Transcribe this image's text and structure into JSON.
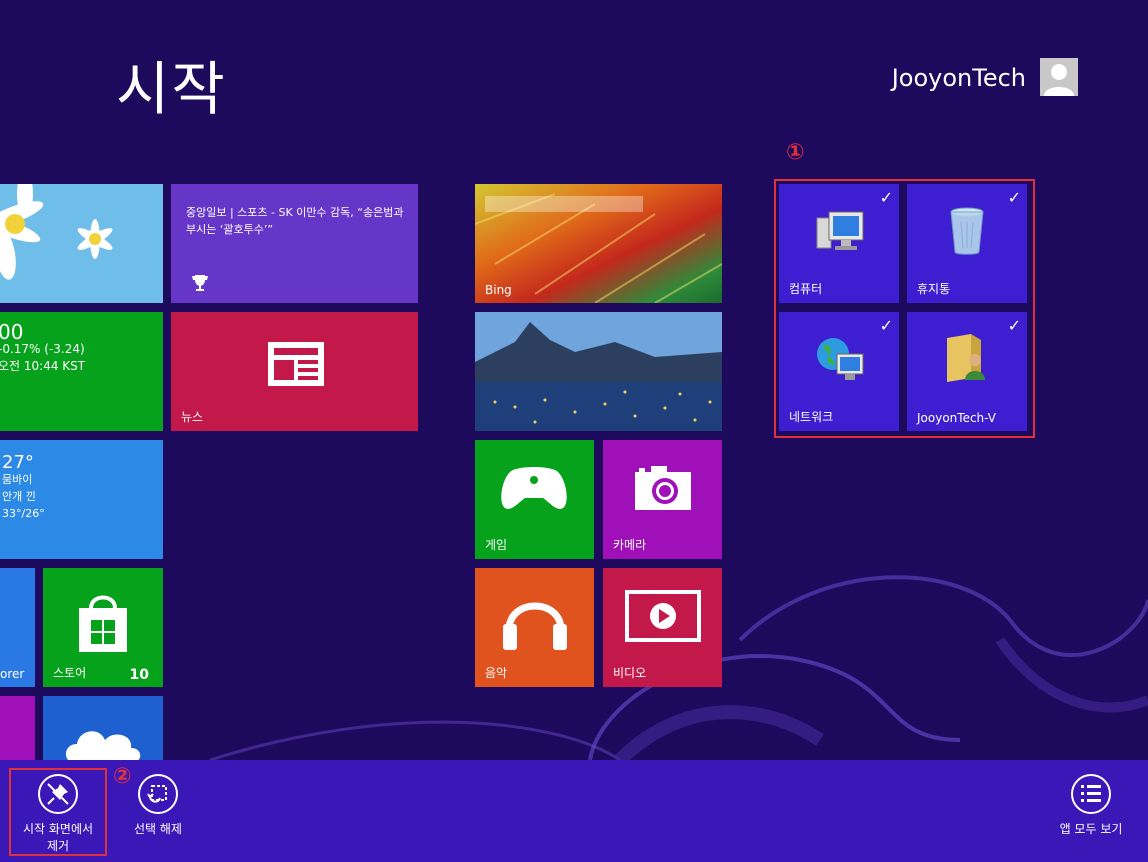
{
  "header": {
    "title": "시작",
    "user_name": "JooyonTech"
  },
  "tiles": {
    "news_headline": "중앙일보 | 스포츠 - SK 이만수 감독, “송은범과 부시는 ‘괄호투수’”",
    "finance": {
      "value": "00",
      "change": "-0.17% (-3.24)",
      "time": "오전 10:44 KST"
    },
    "news_label": "뉴스",
    "weather": {
      "temp": "27°",
      "city": "뭄바이",
      "condition": "안개 낀",
      "range": "33°/26°"
    },
    "bing_label": "Bing",
    "games_label": "게임",
    "camera_label": "카메라",
    "music_label": "음악",
    "video_label": "비디오",
    "ie_label": "orer",
    "store_label": "스토어",
    "store_badge": "10"
  },
  "selected_group": {
    "marker": "①",
    "items": [
      {
        "label": "컴퓨터",
        "checkmark": "✓"
      },
      {
        "label": "휴지통",
        "checkmark": "✓"
      },
      {
        "label": "네트워크",
        "checkmark": "✓"
      },
      {
        "label": "JooyonTech-V",
        "checkmark": "✓"
      }
    ]
  },
  "appbar": {
    "marker": "②",
    "unpin_label_line1": "시작 화면에서",
    "unpin_label_line2": "제거",
    "clear_label": "선택 해제",
    "all_apps_label": "앱 모두 보기"
  },
  "colors": {
    "background": "#1e0a5c",
    "appbar": "#3b17b7",
    "selection_tile": "#3d1ed0",
    "highlight": "#e0303a"
  }
}
